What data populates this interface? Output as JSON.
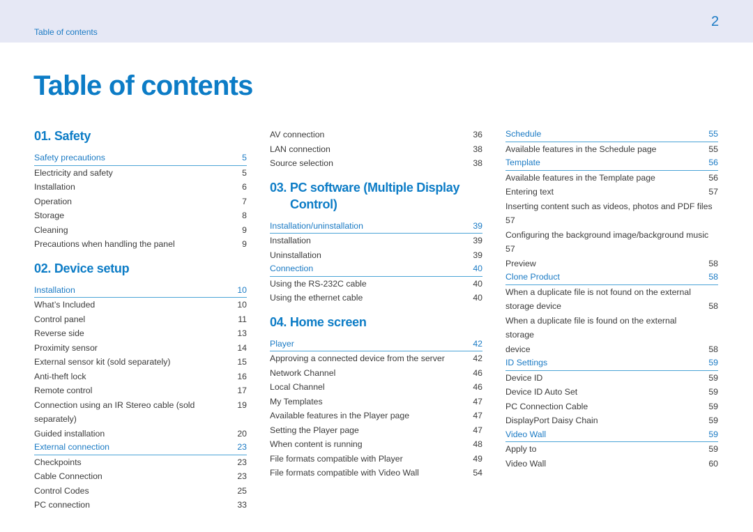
{
  "header": {
    "breadcrumb": "Table of contents",
    "page_number": "2"
  },
  "title": "Table of contents",
  "columns": [
    {
      "blocks": [
        {
          "type": "section",
          "title": "01. Safety"
        },
        {
          "type": "sub",
          "label": "Safety precautions",
          "page": "5"
        },
        {
          "type": "item",
          "label": "Electricity and safety",
          "page": "5"
        },
        {
          "type": "item",
          "label": "Installation",
          "page": "6"
        },
        {
          "type": "item",
          "label": "Operation",
          "page": "7"
        },
        {
          "type": "item",
          "label": "Storage",
          "page": "8"
        },
        {
          "type": "item",
          "label": "Cleaning",
          "page": "9"
        },
        {
          "type": "item",
          "label": "Precautions when handling the panel",
          "page": "9"
        },
        {
          "type": "section",
          "title": "02. Device setup"
        },
        {
          "type": "sub",
          "label": "Installation",
          "page": "10"
        },
        {
          "type": "item",
          "label": "What’s Included",
          "page": "10"
        },
        {
          "type": "item",
          "label": "Control panel",
          "page": "11"
        },
        {
          "type": "item",
          "label": "Reverse side",
          "page": "13"
        },
        {
          "type": "item",
          "label": "Proximity sensor",
          "page": "14"
        },
        {
          "type": "item",
          "label": "External sensor kit (sold separately)",
          "page": "15"
        },
        {
          "type": "item",
          "label": "Anti-theft lock",
          "page": "16"
        },
        {
          "type": "item",
          "label": "Remote control",
          "page": "17"
        },
        {
          "type": "item",
          "label": "Connection using an IR Stereo cable (sold separately)",
          "page": "19"
        },
        {
          "type": "item",
          "label": "Guided installation",
          "page": "20"
        },
        {
          "type": "sub",
          "label": "External connection",
          "page": "23"
        },
        {
          "type": "item",
          "label": "Checkpoints",
          "page": "23"
        },
        {
          "type": "item",
          "label": "Cable Connection",
          "page": "23"
        },
        {
          "type": "item",
          "label": "Control Codes",
          "page": "25"
        },
        {
          "type": "item",
          "label": "PC connection",
          "page": "33"
        }
      ]
    },
    {
      "blocks": [
        {
          "type": "item",
          "label": "AV connection",
          "page": "36"
        },
        {
          "type": "item",
          "label": "LAN connection",
          "page": "38"
        },
        {
          "type": "item",
          "label": "Source selection",
          "page": "38"
        },
        {
          "type": "section",
          "title": "03. PC software (Multiple Display",
          "title_cont": "Control)"
        },
        {
          "type": "sub",
          "label": "Installation/uninstallation",
          "page": "39"
        },
        {
          "type": "item",
          "label": "Installation",
          "page": "39"
        },
        {
          "type": "item",
          "label": "Uninstallation",
          "page": "39"
        },
        {
          "type": "sub",
          "label": "Connection",
          "page": "40"
        },
        {
          "type": "item",
          "label": "Using the RS-232C cable",
          "page": "40"
        },
        {
          "type": "item",
          "label": "Using the ethernet cable",
          "page": "40"
        },
        {
          "type": "section",
          "title": "04. Home screen"
        },
        {
          "type": "sub",
          "label": "Player",
          "page": "42"
        },
        {
          "type": "item",
          "label": "Approving a connected device from the server",
          "page": "42"
        },
        {
          "type": "item",
          "label": "Network Channel",
          "page": "46"
        },
        {
          "type": "item",
          "label": "Local Channel",
          "page": "46"
        },
        {
          "type": "item",
          "label": "My Templates",
          "page": "47"
        },
        {
          "type": "item",
          "label": "Available features in the Player page",
          "page": "47"
        },
        {
          "type": "item",
          "label": "Setting the Player page",
          "page": "47"
        },
        {
          "type": "item",
          "label": "When content is running",
          "page": "48"
        },
        {
          "type": "item",
          "label": "File formats compatible with Player",
          "page": "49"
        },
        {
          "type": "item",
          "label": "File formats compatible with Video Wall",
          "page": "54"
        }
      ]
    },
    {
      "blocks": [
        {
          "type": "sub",
          "label": "Schedule",
          "page": "55"
        },
        {
          "type": "item",
          "label": "Available features in the Schedule page",
          "page": "55"
        },
        {
          "type": "sub",
          "label": "Template",
          "page": "56"
        },
        {
          "type": "item",
          "label": "Available features in the Template page",
          "page": "56"
        },
        {
          "type": "item",
          "label": "Entering text",
          "page": "57"
        },
        {
          "type": "wrap",
          "label": "Inserting content such as videos, photos and PDF files",
          "label2": "57",
          "page": ""
        },
        {
          "type": "wrap",
          "label": "Configuring the background image/background music",
          "label2": "57",
          "page": ""
        },
        {
          "type": "item",
          "label": "Preview",
          "page": "58"
        },
        {
          "type": "sub",
          "label": "Clone Product",
          "page": "58"
        },
        {
          "type": "wrap",
          "label": "When a duplicate file is not found on the external",
          "label2": "storage device",
          "page": "58"
        },
        {
          "type": "wrap",
          "label": "When a duplicate file is found on the external storage",
          "label2": "device",
          "page": "58"
        },
        {
          "type": "sub",
          "label": "ID Settings",
          "page": "59"
        },
        {
          "type": "item",
          "label": "Device ID",
          "page": "59"
        },
        {
          "type": "item",
          "label": "Device ID Auto Set",
          "page": "59"
        },
        {
          "type": "item",
          "label": "PC Connection Cable",
          "page": "59"
        },
        {
          "type": "item",
          "label": "DisplayPort Daisy Chain",
          "page": "59"
        },
        {
          "type": "sub",
          "label": "Video Wall",
          "page": "59"
        },
        {
          "type": "item",
          "label": "Apply to",
          "page": "59"
        },
        {
          "type": "item",
          "label": "Video Wall",
          "page": "60"
        }
      ]
    }
  ]
}
